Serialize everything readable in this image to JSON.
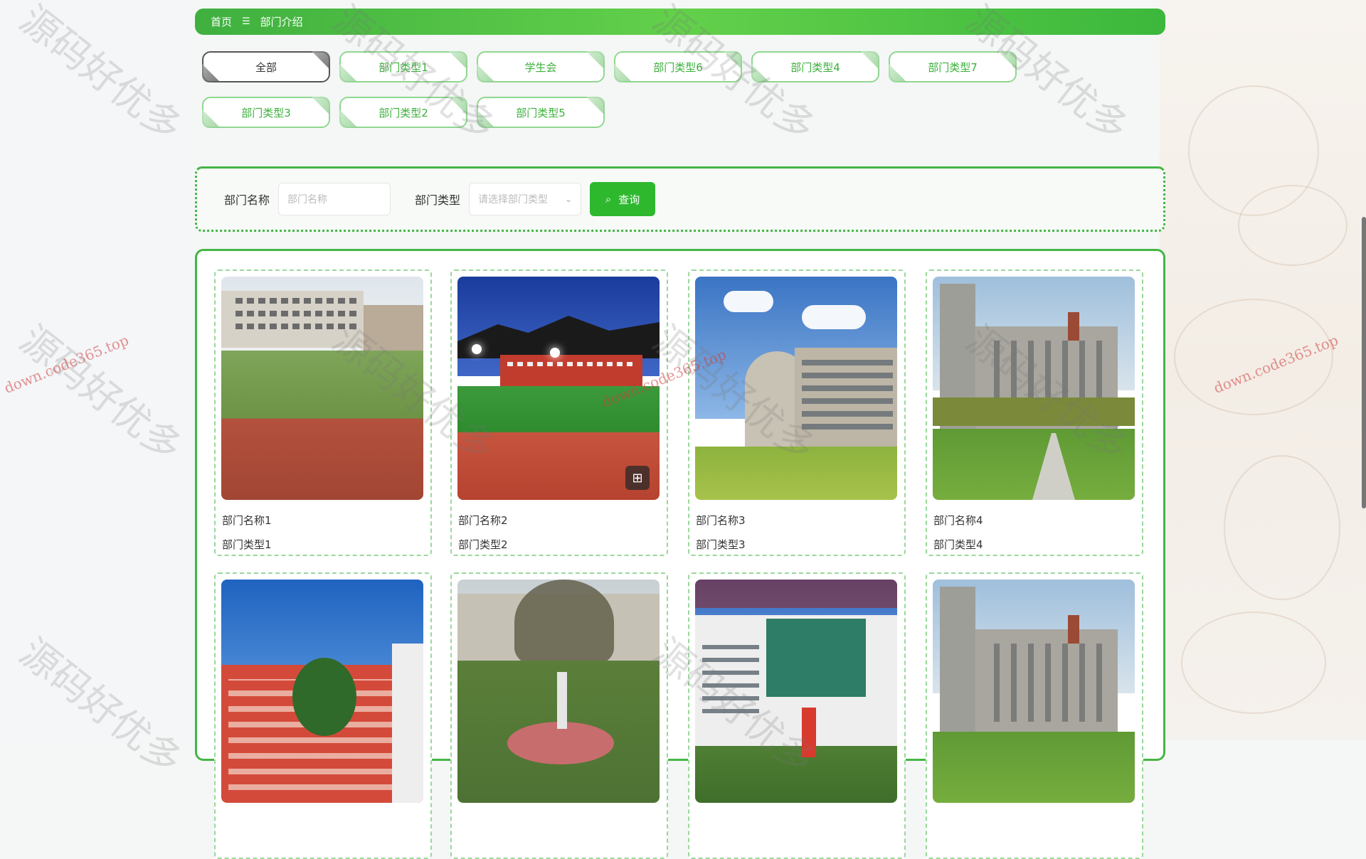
{
  "breadcrumb": {
    "home": "首页",
    "separator": "☰",
    "current": "部门介绍"
  },
  "types": [
    {
      "label": "全部",
      "active": true
    },
    {
      "label": "部门类型1",
      "active": false
    },
    {
      "label": "学生会",
      "active": false
    },
    {
      "label": "部门类型6",
      "active": false
    },
    {
      "label": "部门类型4",
      "active": false
    },
    {
      "label": "部门类型7",
      "active": false
    },
    {
      "label": "部门类型3",
      "active": false
    },
    {
      "label": "部门类型2",
      "active": false
    },
    {
      "label": "部门类型5",
      "active": false
    }
  ],
  "search": {
    "name_label": "部门名称",
    "name_placeholder": "部门名称",
    "type_label": "部门类型",
    "type_placeholder": "请选择部门类型",
    "button_label": "查询"
  },
  "cards": [
    {
      "name": "部门名称1",
      "type": "部门类型1",
      "scene": "field"
    },
    {
      "name": "部门名称2",
      "type": "部门类型2",
      "scene": "stadium"
    },
    {
      "name": "部门名称3",
      "type": "部门类型3",
      "scene": "campus"
    },
    {
      "name": "部门名称4",
      "type": "部门类型4",
      "scene": "castle"
    },
    {
      "name": "",
      "type": "",
      "scene": "redbldg"
    },
    {
      "name": "",
      "type": "",
      "scene": "garden"
    },
    {
      "name": "",
      "type": "",
      "scene": "tower"
    },
    {
      "name": "",
      "type": "",
      "scene": "castle"
    }
  ],
  "watermarks": {
    "text": "源码好优多",
    "url": "down.code365.top"
  },
  "colors": {
    "accent": "#3bb03b",
    "border": "#45b545",
    "dark": "#555555"
  }
}
